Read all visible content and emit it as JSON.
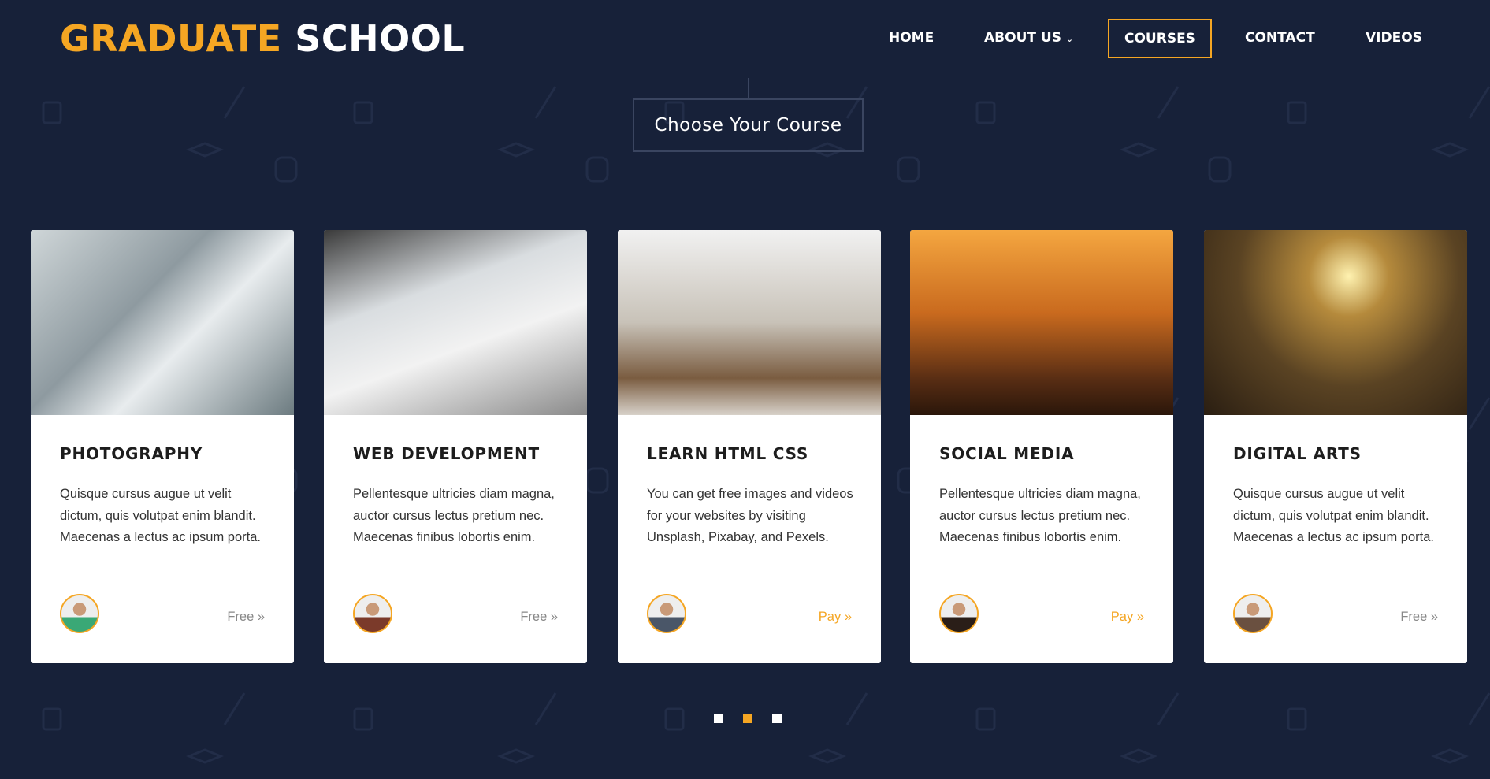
{
  "brand": {
    "first": "GRADUATE",
    "second": "SCHOOL"
  },
  "nav": {
    "items": [
      {
        "label": "HOME"
      },
      {
        "label": "ABOUT US",
        "has_dropdown": true
      },
      {
        "label": "COURSES",
        "active": true
      },
      {
        "label": "CONTACT"
      },
      {
        "label": "VIDEOS"
      }
    ]
  },
  "section": {
    "title": "Choose Your Course"
  },
  "courses": [
    {
      "title": "PHOTOGRAPHY",
      "description": "Quisque cursus augue ut velit dictum, quis volutpat enim blandit. Maecenas a lectus ac ipsum porta.",
      "price": "Free »"
    },
    {
      "title": "WEB DEVELOPMENT",
      "description": "Pellentesque ultricies diam magna, auctor cursus lectus pretium nec. Maecenas finibus lobortis enim.",
      "price": "Free »"
    },
    {
      "title": "LEARN HTML CSS",
      "description": "You can get free images and videos for your websites by visiting Unsplash, Pixabay, and Pexels.",
      "price": "Pay »"
    },
    {
      "title": "SOCIAL MEDIA",
      "description": "Pellentesque ultricies diam magna, auctor cursus lectus pretium nec. Maecenas finibus lobortis enim.",
      "price": "Pay »"
    },
    {
      "title": "DIGITAL ARTS",
      "description": "Quisque cursus augue ut velit dictum, quis volutpat enim blandit. Maecenas a lectus ac ipsum porta.",
      "price": "Free »"
    }
  ],
  "carousel": {
    "pages": 3,
    "active_page": 2
  },
  "colors": {
    "background": "#172139",
    "accent": "#f5a623",
    "card": "#ffffff"
  }
}
